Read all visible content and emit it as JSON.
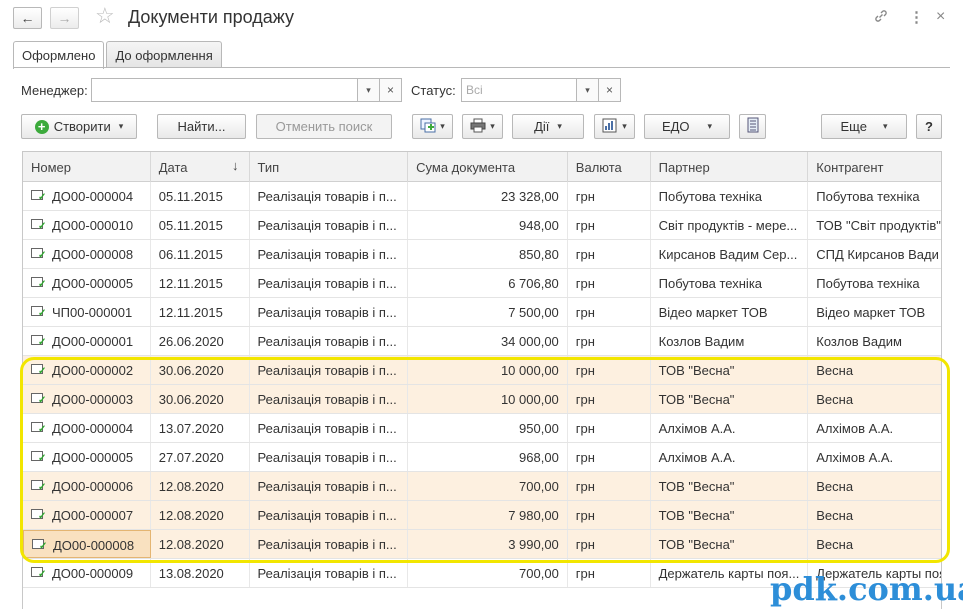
{
  "window": {
    "title": "Документи продажу",
    "back_icon": "←",
    "forward_icon": "→",
    "star_icon": "☆",
    "link_icon": "🔗",
    "menu_icon": "⋮",
    "close_icon": "×"
  },
  "tabs": [
    {
      "label": "Оформлено",
      "active": true
    },
    {
      "label": "До оформлення",
      "active": false
    }
  ],
  "filters": {
    "manager_label": "Менеджер:",
    "manager_value": "",
    "status_label": "Статус:",
    "status_placeholder": "Всі",
    "dropdown_glyph": "▾",
    "clear_glyph": "×"
  },
  "toolbar": {
    "create_label": "Створити",
    "find_label": "Найти...",
    "cancel_search_label": "Отменить поиск",
    "actions_label": "Дії",
    "edo_label": "ЕДО",
    "more_label": "Еще",
    "help_label": "?",
    "arrow": "▾"
  },
  "table": {
    "columns": [
      "Номер",
      "Дата",
      "Тип",
      "Сума документа",
      "Валюта",
      "Партнер",
      "Контрагент"
    ],
    "sort_indicator": "↓",
    "rows": [
      {
        "number": "ДО00-000004",
        "date": "05.11.2015",
        "type": "Реалізація товарів і п...",
        "sum": "23 328,00",
        "currency": "грн",
        "partner": "Побутова техніка",
        "contractor": "Побутова техніка",
        "highlight": false
      },
      {
        "number": "ДО00-000010",
        "date": "05.11.2015",
        "type": "Реалізація товарів і п...",
        "sum": "948,00",
        "currency": "грн",
        "partner": "Світ продуктів - мере...",
        "contractor": "ТОВ \"Світ продуктів\"",
        "highlight": false
      },
      {
        "number": "ДО00-000008",
        "date": "06.11.2015",
        "type": "Реалізація товарів і п...",
        "sum": "850,80",
        "currency": "грн",
        "partner": "Кирсанов Вадим Сер...",
        "contractor": "СПД Кирсанов Вади",
        "highlight": false
      },
      {
        "number": "ДО00-000005",
        "date": "12.11.2015",
        "type": "Реалізація товарів і п...",
        "sum": "6 706,80",
        "currency": "грн",
        "partner": "Побутова техніка",
        "contractor": "Побутова техніка",
        "highlight": false
      },
      {
        "number": "ЧП00-000001",
        "date": "12.11.2015",
        "type": "Реалізація товарів і п...",
        "sum": "7 500,00",
        "currency": "грн",
        "partner": "Відео маркет ТОВ",
        "contractor": "Відео маркет ТОВ",
        "highlight": false
      },
      {
        "number": "ДО00-000001",
        "date": "26.06.2020",
        "type": "Реалізація товарів і п...",
        "sum": "34 000,00",
        "currency": "грн",
        "partner": "Козлов Вадим",
        "contractor": "Козлов Вадим",
        "highlight": false
      },
      {
        "number": "ДО00-000002",
        "date": "30.06.2020",
        "type": "Реалізація товарів і п...",
        "sum": "10 000,00",
        "currency": "грн",
        "partner": "ТОВ \"Весна\"",
        "contractor": "Весна",
        "highlight": true
      },
      {
        "number": "ДО00-000003",
        "date": "30.06.2020",
        "type": "Реалізація товарів і п...",
        "sum": "10 000,00",
        "currency": "грн",
        "partner": "ТОВ \"Весна\"",
        "contractor": "Весна",
        "highlight": true
      },
      {
        "number": "ДО00-000004",
        "date": "13.07.2020",
        "type": "Реалізація товарів і п...",
        "sum": "950,00",
        "currency": "грн",
        "partner": "Алхімов А.А.",
        "contractor": "Алхімов А.А.",
        "highlight": false
      },
      {
        "number": "ДО00-000005",
        "date": "27.07.2020",
        "type": "Реалізація товарів і п...",
        "sum": "968,00",
        "currency": "грн",
        "partner": "Алхімов А.А.",
        "contractor": "Алхімов А.А.",
        "highlight": false
      },
      {
        "number": "ДО00-000006",
        "date": "12.08.2020",
        "type": "Реалізація товарів і п...",
        "sum": "700,00",
        "currency": "грн",
        "partner": "ТОВ \"Весна\"",
        "contractor": "Весна",
        "highlight": true
      },
      {
        "number": "ДО00-000007",
        "date": "12.08.2020",
        "type": "Реалізація товарів і п...",
        "sum": "7 980,00",
        "currency": "грн",
        "partner": "ТОВ \"Весна\"",
        "contractor": "Весна",
        "highlight": true
      },
      {
        "number": "ДО00-000008",
        "date": "12.08.2020",
        "type": "Реалізація товарів і п...",
        "sum": "3 990,00",
        "currency": "грн",
        "partner": "ТОВ \"Весна\"",
        "contractor": "Весна",
        "highlight": true,
        "selected": true
      },
      {
        "number": "ДО00-000009",
        "date": "13.08.2020",
        "type": "Реалізація товарів і п...",
        "sum": "700,00",
        "currency": "грн",
        "partner": "Держатель карты поя...",
        "contractor": "Держатель карты поя",
        "highlight": false
      }
    ]
  },
  "watermark": "pdk.com.ua",
  "colors": {
    "highlight_row": "#fdf0e0",
    "frame": "#f2e600",
    "watermark": "#2d8ed8",
    "create_icon": "#3caa3c"
  }
}
